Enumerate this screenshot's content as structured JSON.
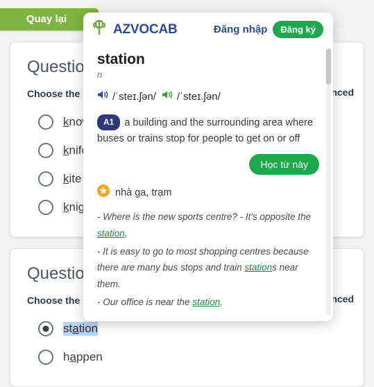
{
  "quiz": {
    "back_button": "Quay lại",
    "questions": [
      {
        "title": "Question",
        "prompt": "Choose the",
        "prompt_tail": "ounced",
        "options": [
          {
            "prefix": "k",
            "rest": "now",
            "selected": false
          },
          {
            "prefix": "k",
            "rest": "nife",
            "selected": false
          },
          {
            "prefix": "k",
            "rest": "ite",
            "selected": false
          },
          {
            "prefix": "k",
            "rest": "night",
            "selected": false
          }
        ]
      },
      {
        "title": "Question",
        "prompt": "Choose the",
        "prompt_tail": "ounced",
        "options": [
          {
            "prefix": "st",
            "mid": "a",
            "rest": "tion",
            "selected": true
          },
          {
            "prefix": "h",
            "mid": "a",
            "rest": "ppen",
            "selected": false
          }
        ]
      }
    ]
  },
  "popup": {
    "logo_text": "AZVOCAB",
    "logo_icon": "leaf-logo-icon",
    "login_label": "Đăng nhập",
    "signup_label": "Đăng ký",
    "word": "station",
    "part_of_speech": "n",
    "phonetics": [
      {
        "icon": "speaker-icon-uk",
        "ipa": "/ˈsteɪ.ʃən/",
        "color": "#2a4b9b"
      },
      {
        "icon": "speaker-icon-us",
        "ipa": "/ˈsteɪ.ʃən/",
        "color": "#3a9a36"
      }
    ],
    "cefr_level": "A1",
    "definition": "a building and the surrounding area where buses or trains stop for people to get on or off",
    "learn_button": "Học từ này",
    "star_icon": "star-icon",
    "translation": "nhà ga, trạm",
    "examples": [
      {
        "before": "- Where is the new sports centre? - It's opposite the ",
        "word": "station",
        "after": "."
      },
      {
        "before": "- It is easy to go to most shopping centres because there are many bus stops and train ",
        "word": "station",
        "after": "s near them."
      },
      {
        "before": "- Our office is near the ",
        "word": "station",
        "after": "."
      }
    ]
  },
  "colors": {
    "brand_blue": "#2a4b9b",
    "brand_green": "#1da84e",
    "back_green": "#7eb442",
    "cefr_navy": "#2e3a76",
    "star_orange": "#f5a623",
    "example_green": "#1f8a3c",
    "selection_blue": "#b9d3f7"
  }
}
